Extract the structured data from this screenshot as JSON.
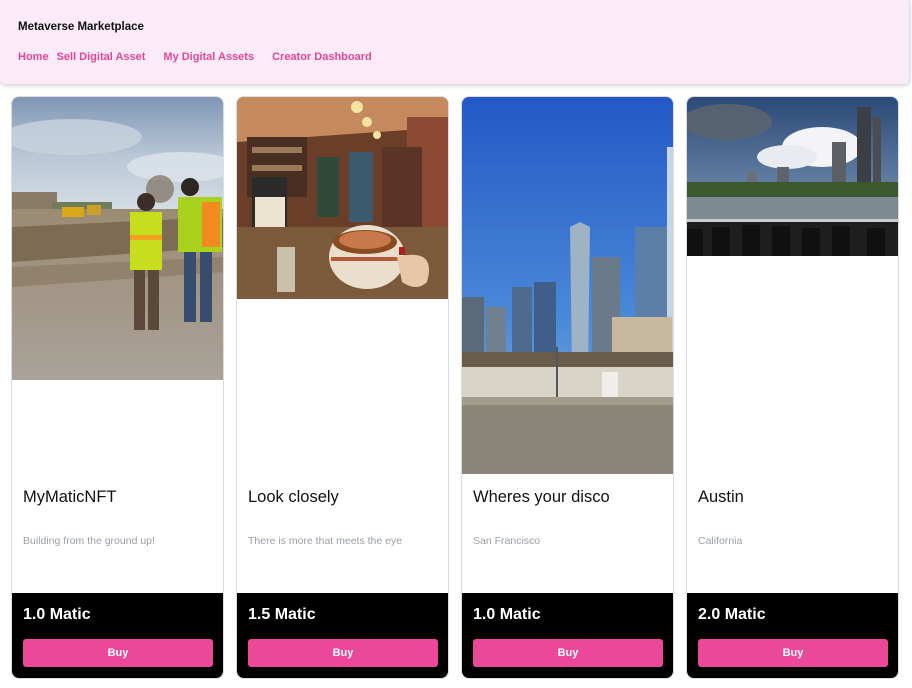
{
  "navbar": {
    "brand": "Metaverse Marketplace",
    "links": [
      "Home",
      "Sell Digital Asset",
      "My Digital Assets",
      "Creator Dashboard"
    ],
    "link_color": "#e0479a",
    "background": "#fbeaf7"
  },
  "cards": [
    {
      "title": "MyMaticNFT",
      "description": "Building from the ground up!",
      "price": "1.0 Matic",
      "buy_label": "Buy",
      "image": "construction-site-photo"
    },
    {
      "title": "Look closely",
      "description": "There is more that meets the eye",
      "price": "1.5 Matic",
      "buy_label": "Buy",
      "image": "retro-diner-painting"
    },
    {
      "title": "Wheres your disco",
      "description": "San Francisco",
      "price": "1.0 Matic",
      "buy_label": "Buy",
      "image": "san-francisco-skyline-photo"
    },
    {
      "title": "Austin",
      "description": "California",
      "price": "2.0 Matic",
      "buy_label": "Buy",
      "image": "austin-skyline-photo"
    }
  ],
  "colors": {
    "buy_button": "#ec4899",
    "card_footer": "#000000",
    "description_text": "#9aa0a6"
  }
}
